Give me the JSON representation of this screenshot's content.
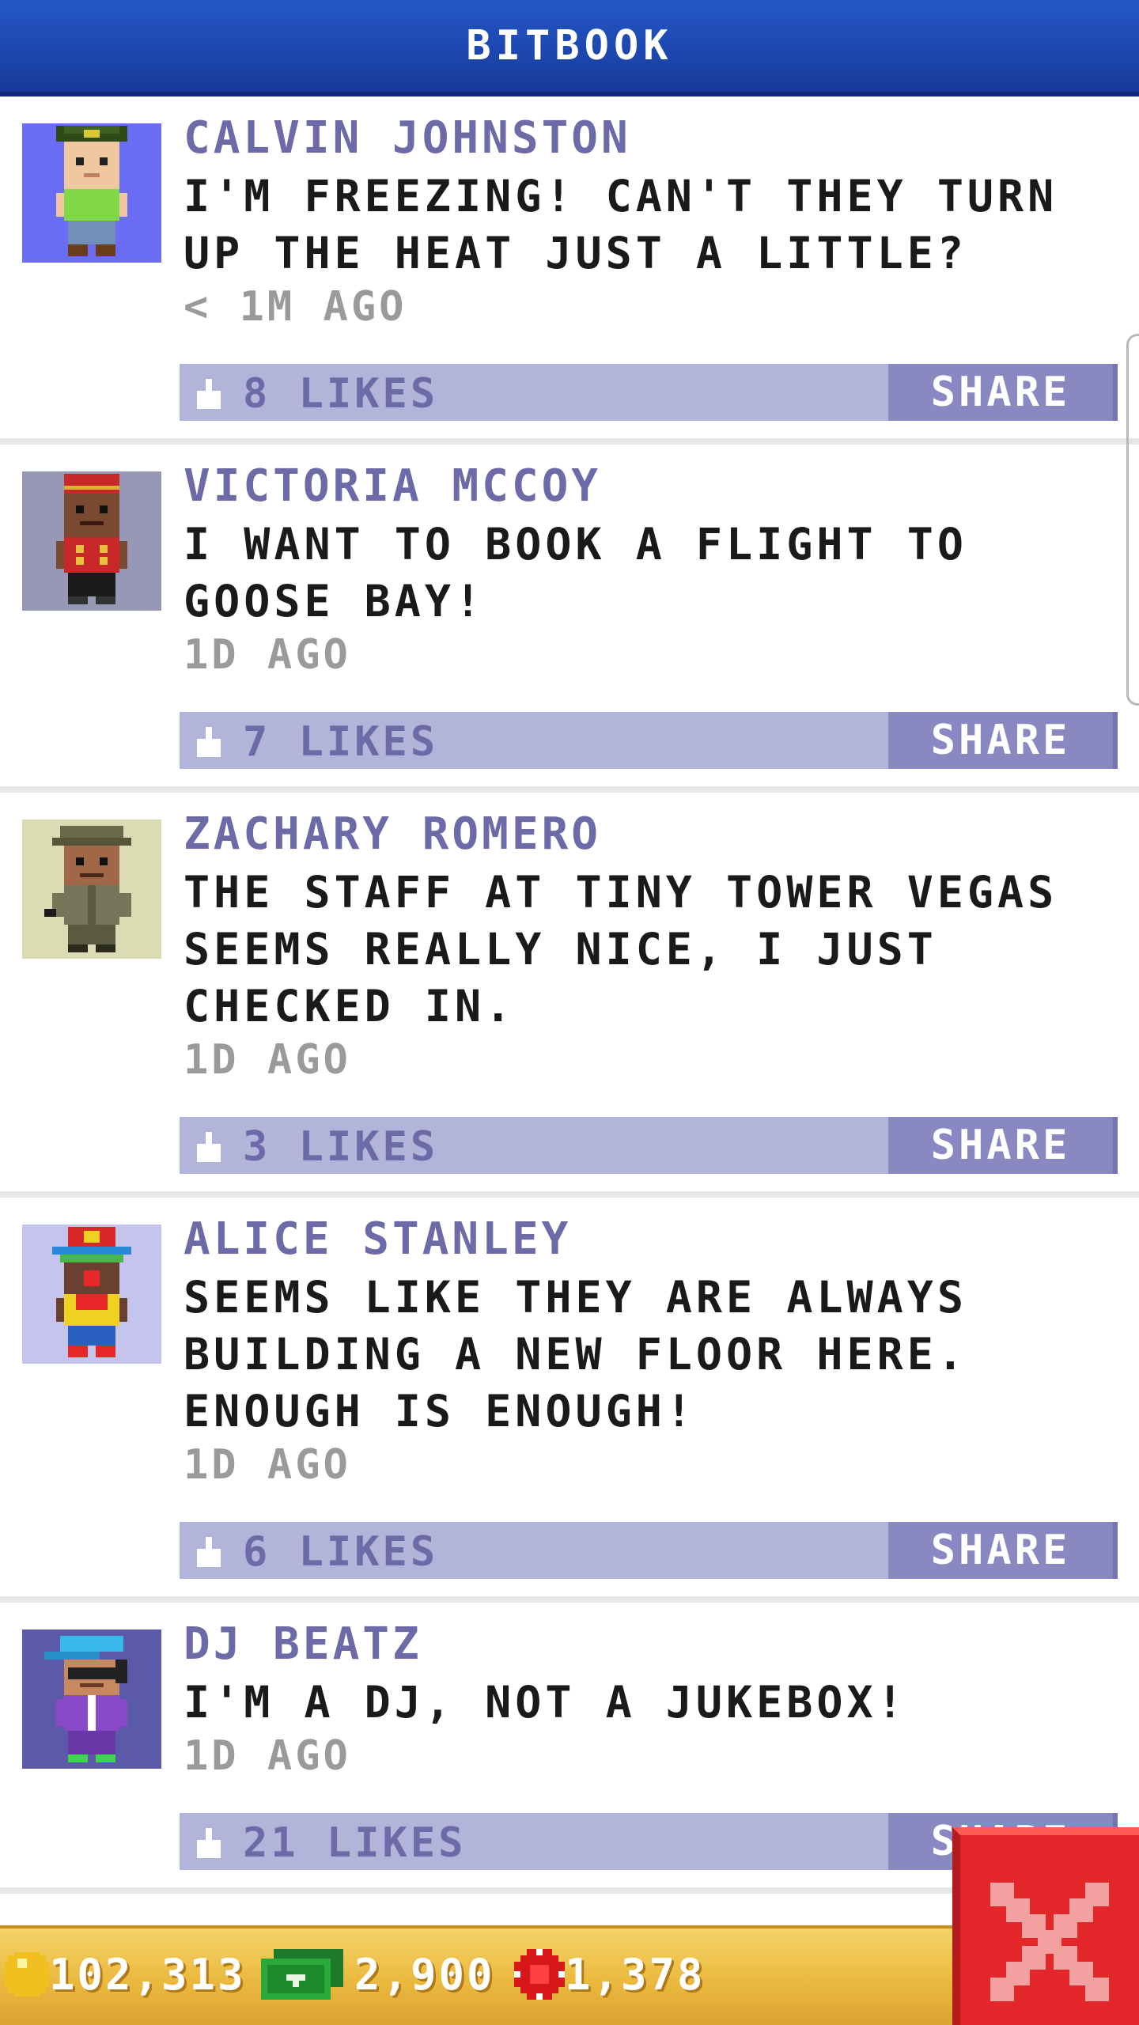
{
  "header": {
    "title": "BITBOOK"
  },
  "posts": [
    {
      "name": "CALVIN JOHNSTON",
      "text": "I'M FREEZING! CAN'T THEY TURN UP THE HEAT JUST A LITTLE?",
      "time": "< 1M AGO",
      "likes": "8 LIKES",
      "share": "SHARE",
      "avatar_bg": "#6b6cf4"
    },
    {
      "name": "VICTORIA MCCOY",
      "text": "I WANT TO BOOK A FLIGHT TO GOOSE BAY!",
      "time": "1D AGO",
      "likes": "7 LIKES",
      "share": "SHARE",
      "avatar_bg": "#9698b5"
    },
    {
      "name": "ZACHARY ROMERO",
      "text": "THE STAFF AT TINY TOWER VEGAS SEEMS REALLY NICE, I JUST CHECKED IN.",
      "time": "1D AGO",
      "likes": "3 LIKES",
      "share": "SHARE",
      "avatar_bg": "#dcdcb4"
    },
    {
      "name": "ALICE STANLEY",
      "text": "SEEMS LIKE THEY ARE ALWAYS BUILDING A NEW FLOOR HERE. ENOUGH IS ENOUGH!",
      "time": "1D AGO",
      "likes": "6 LIKES",
      "share": "SHARE",
      "avatar_bg": "#c4c4ec"
    },
    {
      "name": "DJ BEATZ",
      "text": "I'M A DJ, NOT A JUKEBOX!",
      "time": "1D AGO",
      "likes": "21 LIKES",
      "share": "SHARE",
      "avatar_bg": "#5a5aa8"
    }
  ],
  "currency": {
    "coins": "102,313",
    "bux": "2,900",
    "chips": "1,378"
  },
  "colors": {
    "header": "#1b43a8",
    "name": "#6d6aa8",
    "like_bar": "#b3b4d9",
    "share_button": "#8a88c0",
    "bottom_bar": "#eab93e",
    "close_button": "#e3262a"
  }
}
